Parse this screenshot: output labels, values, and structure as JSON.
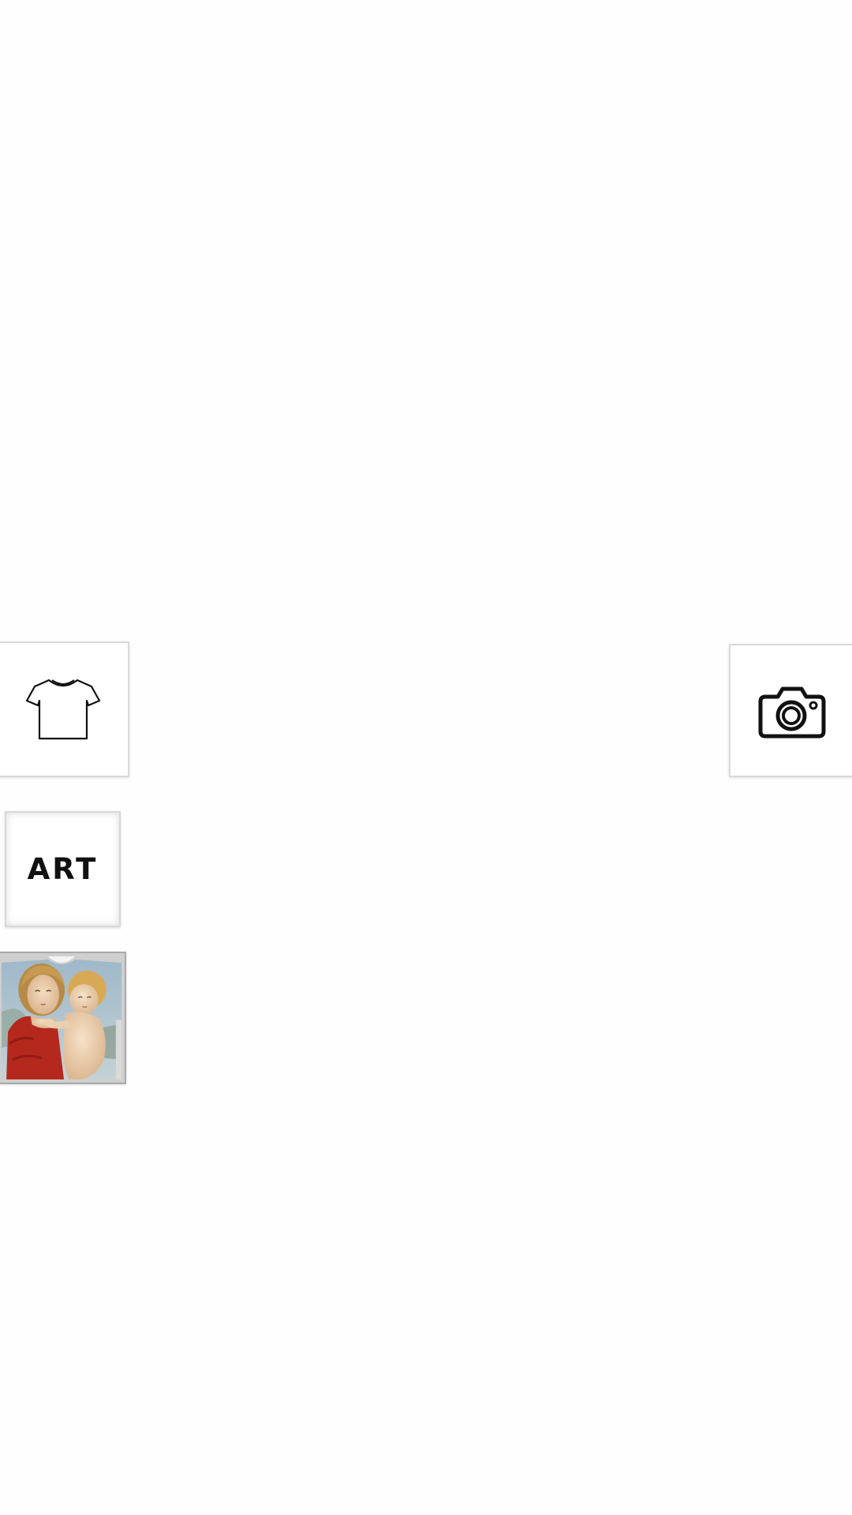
{
  "tools": {
    "shirt": {
      "icon": "t-shirt-icon"
    },
    "camera": {
      "icon": "camera-icon"
    },
    "art": {
      "label": "ART"
    },
    "preview": {
      "icon": "artwork-preview-thumbnail"
    }
  },
  "colors": {
    "background": "#fefefe",
    "tile_border": "#d9d9d9",
    "icon_stroke": "#111111"
  }
}
